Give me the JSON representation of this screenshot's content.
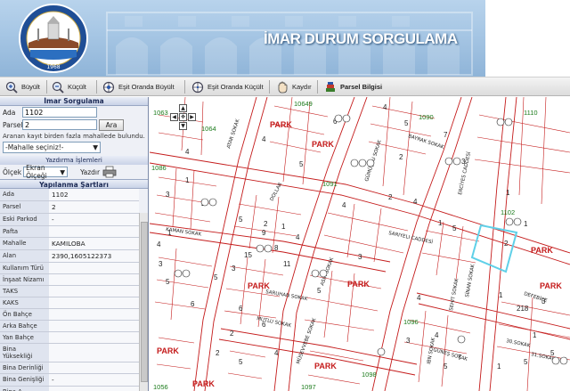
{
  "banner": {
    "title": "İMAR DURUM SORGULAMA",
    "logo_year": "1968"
  },
  "toolbar": {
    "buttons": [
      {
        "label": "Büyült",
        "icon": "zoom-in-icon"
      },
      {
        "label": "Küçült",
        "icon": "zoom-out-icon"
      },
      {
        "label": "Eşit Oranda Büyült",
        "icon": "zoom-in-equal-icon"
      },
      {
        "label": "Eşit Oranda Küçült",
        "icon": "zoom-out-equal-icon"
      },
      {
        "label": "Kaydır",
        "icon": "pan-hand-icon"
      },
      {
        "label": "Parsel Bilgisi",
        "icon": "parcel-info-icon"
      }
    ]
  },
  "query": {
    "title": "İmar Sorgulama",
    "ada_label": "Ada",
    "ada_value": "1102",
    "parsel_label": "Parsel",
    "parsel_value": "2",
    "search_label": "Ara",
    "info": "Aranan kayıt birden fazla mahallede bulundu.",
    "mahalle_placeholder": "-Mahalle seçiniz!-",
    "print_title": "Yazdırma İşlemleri",
    "olcek_label": "Ölçek",
    "olcek_value": "Ekran Ölçeği",
    "print_label": "Yazdır"
  },
  "conditions": {
    "title": "Yapılanma Şartları",
    "rows": [
      {
        "k": "Ada",
        "v": "1102"
      },
      {
        "k": "Parsel",
        "v": "2"
      },
      {
        "k": "Eski Parkod",
        "v": "-"
      },
      {
        "k": "Pafta",
        "v": ""
      },
      {
        "k": "Mahalle",
        "v": "KAMILOBA"
      },
      {
        "k": "Alan",
        "v": "2390,1605122373"
      },
      {
        "k": "Kullanım Türü",
        "v": ""
      },
      {
        "k": "İnşaat Nizamı",
        "v": ""
      },
      {
        "k": "TAKS",
        "v": ""
      },
      {
        "k": "KAKS",
        "v": ""
      },
      {
        "k": "Ön Bahçe",
        "v": ""
      },
      {
        "k": "Arka Bahçe",
        "v": ""
      },
      {
        "k": "Yan Bahçe",
        "v": ""
      },
      {
        "k": "Bina Yüksekliği",
        "v": ""
      },
      {
        "k": "Bina Derinliği",
        "v": ""
      },
      {
        "k": "Bina Genişliği",
        "v": "-"
      },
      {
        "k": "Bina A...",
        "v": ""
      }
    ]
  },
  "map": {
    "streets": [
      "ATAR SOKAK",
      "BAYRAK SOKAK",
      "GÜMÜŞSU SOKAK",
      "ERCİYES CADDESİ",
      "DOLLAR",
      "SARIYELI CADDESİ",
      "KAMAN SOKAK",
      "SAMANLAR",
      "SARUHAN SOKAK",
      "MUTLU SOKAK",
      "MÜSEVVEBE SOKAK",
      "GÜNEŞ SOKAK",
      "30.SOKAK",
      "31.SOKAK",
      "DEFEBİÇE",
      "IBN SOKAK",
      "SEHIT SOKAK",
      "SİNAN SOKAK",
      "ASIR SOKAK",
      "BARIŞ SOKAK",
      "CANLI SOKAK"
    ],
    "block_numbers": [
      "1063",
      "1064",
      "10649",
      "1090",
      "1091",
      "1102",
      "1110",
      "1086",
      "1096",
      "1098",
      "1097",
      "1056",
      "1092",
      "1089"
    ],
    "park_label": "PARK"
  }
}
